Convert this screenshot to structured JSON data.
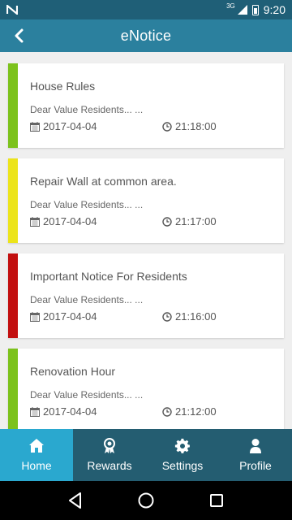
{
  "status_bar": {
    "network_type": "3G",
    "time": "9:20"
  },
  "app_bar": {
    "title": "eNotice"
  },
  "notices": [
    {
      "title": "House Rules",
      "snippet": "Dear Value Residents... ...",
      "date": "2017-04-04",
      "time": "21:18:00",
      "color": "#7cc21c"
    },
    {
      "title": "Repair Wall at common area.",
      "snippet": "Dear Value Residents... ...",
      "date": "2017-04-04",
      "time": "21:17:00",
      "color": "#ece41a"
    },
    {
      "title": "Important Notice For Residents",
      "snippet": "Dear Value Residents... ...",
      "date": "2017-04-04",
      "time": "21:16:00",
      "color": "#c20f0f"
    },
    {
      "title": "Renovation Hour",
      "snippet": "Dear Value Residents... ...",
      "date": "2017-04-04",
      "time": "21:12:00",
      "color": "#7cc21c"
    }
  ],
  "bottom_nav": {
    "items": [
      {
        "label": "Home",
        "icon": "home-icon",
        "active": true
      },
      {
        "label": "Rewards",
        "icon": "award-icon",
        "active": false
      },
      {
        "label": "Settings",
        "icon": "gear-icon",
        "active": false
      },
      {
        "label": "Profile",
        "icon": "user-icon",
        "active": false
      }
    ]
  },
  "system_nav": {
    "icons": [
      "back-triangle-icon",
      "home-circle-icon",
      "recents-square-icon"
    ]
  }
}
